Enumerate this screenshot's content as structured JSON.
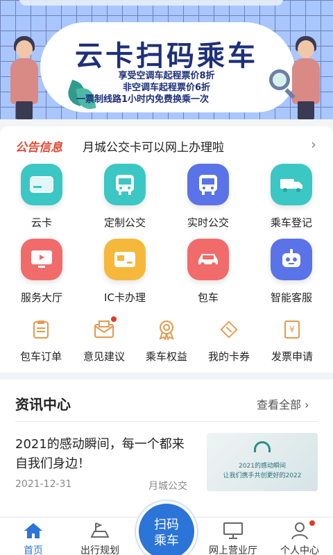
{
  "banner": {
    "title": "云卡扫码乘车",
    "line1": "享受空调车起程票价8折",
    "line2": "非空调车起程票价6折",
    "line3": "一票制线路1小时内免费换乘一次"
  },
  "notice": {
    "tag": "公告信息",
    "text": "月城公交卡可以网上办理啦",
    "arrow": "›"
  },
  "services": [
    {
      "label": "云卡",
      "icon": "card-icon",
      "color": "#3bc7c4"
    },
    {
      "label": "定制公交",
      "icon": "bus-icon",
      "color": "#3bc7c4"
    },
    {
      "label": "实时公交",
      "icon": "bus-icon",
      "color": "#5a73e8"
    },
    {
      "label": "乘车登记",
      "icon": "truck-icon",
      "color": "#3bc7c4"
    },
    {
      "label": "服务大厅",
      "icon": "monitor-icon",
      "color": "#f26b6b"
    },
    {
      "label": "IC卡办理",
      "icon": "ic-card-icon",
      "color": "#f5b83a"
    },
    {
      "label": "包车",
      "icon": "car-icon",
      "color": "#f26b6b"
    },
    {
      "label": "智能客服",
      "icon": "robot-icon",
      "color": "#5a73e8"
    }
  ],
  "shortcuts": [
    {
      "label": "包车订单",
      "icon": "order-icon"
    },
    {
      "label": "意见建议",
      "icon": "mail-icon"
    },
    {
      "label": "乘车权益",
      "icon": "medal-icon"
    },
    {
      "label": "我的卡券",
      "icon": "ticket-icon"
    },
    {
      "label": "发票申请",
      "icon": "invoice-icon"
    }
  ],
  "news": {
    "title": "资讯中心",
    "more": "查看全部 ›",
    "article": {
      "title": "2021的感动瞬间，每一个都来自我们身边！",
      "date": "2021-12-31",
      "source": "月城公交",
      "thumb_line1": "2021的感动瞬间",
      "thumb_line2": "让我们携手共创更好的2022"
    }
  },
  "tabs": [
    {
      "label": "首页",
      "icon": "home-icon"
    },
    {
      "label": "出行规划",
      "icon": "route-icon"
    },
    {
      "label": "网上营业厅",
      "icon": "desktop-icon"
    },
    {
      "label": "个人中心",
      "icon": "user-icon"
    }
  ],
  "scan": {
    "line1": "扫码",
    "line2": "乘车"
  },
  "colors": {
    "accent": "#2b74d8",
    "notice": "#e24b35",
    "badge": "#e23a2e"
  }
}
